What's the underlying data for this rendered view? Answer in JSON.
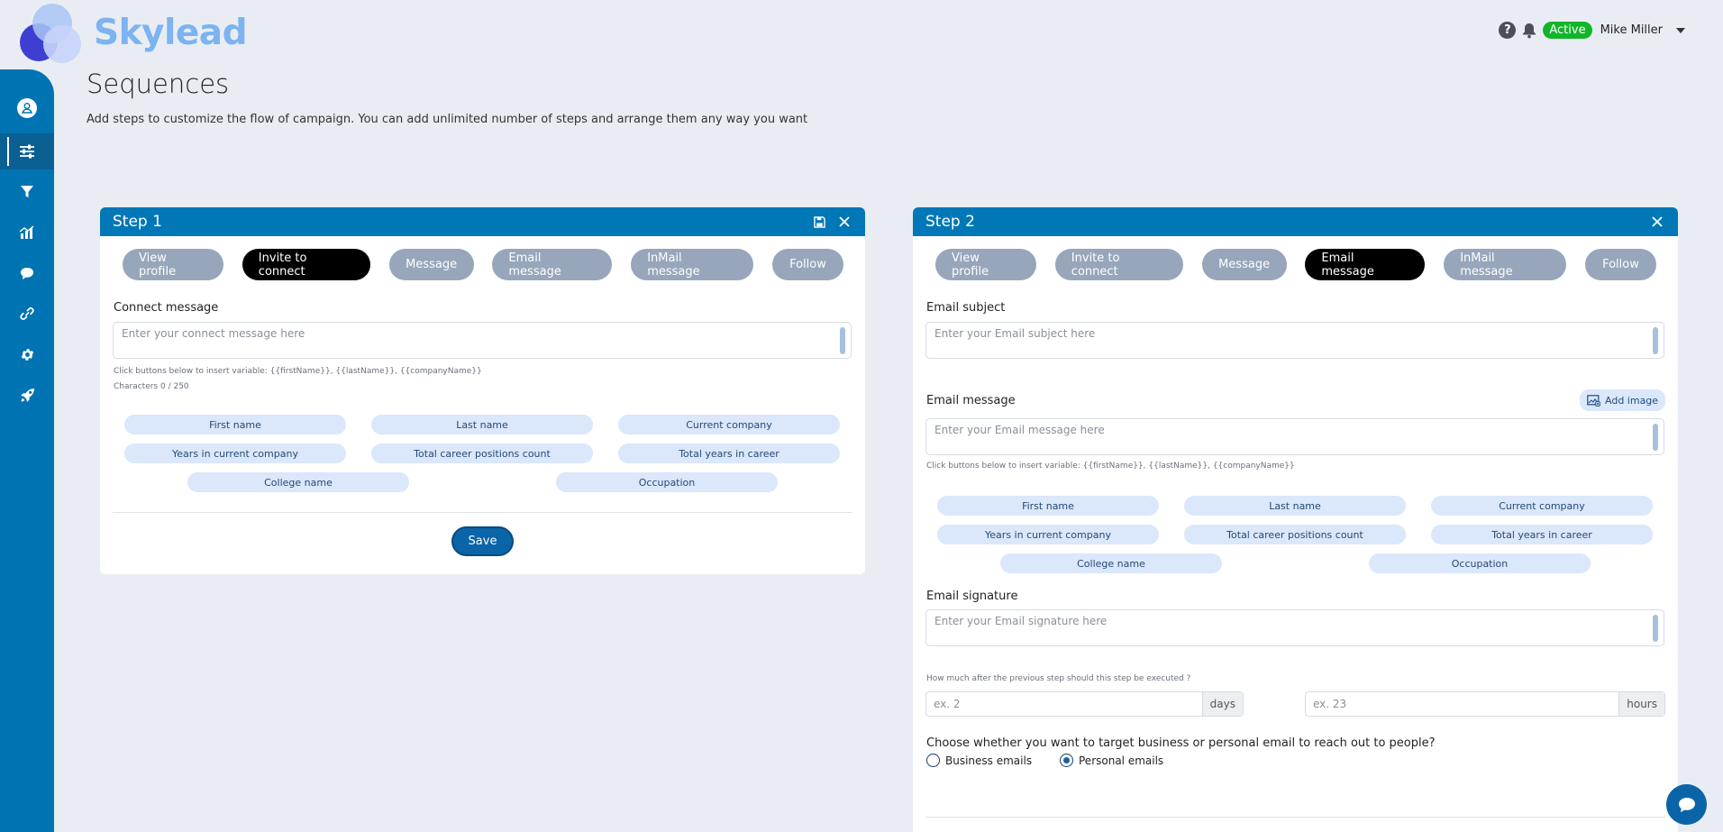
{
  "brand": {
    "name": "Skylead"
  },
  "topbar": {
    "help_icon": "question-circle-icon",
    "bell_icon": "bell-icon",
    "status": "Active",
    "user_name": "Mike Miller",
    "status_color": "#11b52a"
  },
  "sidebar": {
    "items": [
      {
        "icon": "user-icon"
      },
      {
        "icon": "sliders-icon"
      },
      {
        "icon": "filter-icon"
      },
      {
        "icon": "chart-icon"
      },
      {
        "icon": "chat-icon"
      },
      {
        "icon": "link-icon"
      },
      {
        "icon": "gear-icon"
      },
      {
        "icon": "rocket-icon"
      }
    ]
  },
  "page": {
    "title": "Sequences",
    "subtitle": "Add steps to customize the flow of campaign. You can add unlimited number of steps and arrange them any way you want"
  },
  "step1": {
    "title": "Step 1",
    "types": [
      "View profile",
      "Invite to connect",
      "Message",
      "Email message",
      "InMail message",
      "Follow"
    ],
    "selected": "Invite to connect",
    "connect_label": "Connect message",
    "connect_placeholder": "Enter your connect message here",
    "hint": "Click buttons below to insert variable: {{firstName}}, {{lastName}}, {{companyName}}",
    "chars": "Characters 0 / 250",
    "variables": [
      "First name",
      "Last name",
      "Current company",
      "Years in current company",
      "Total career positions count",
      "Total years in career",
      "College name",
      "Occupation"
    ],
    "save": "Save"
  },
  "step2": {
    "title": "Step 2",
    "types": [
      "View profile",
      "Invite to connect",
      "Message",
      "Email message",
      "InMail message",
      "Follow"
    ],
    "selected": "Email message",
    "subject_label": "Email subject",
    "subject_placeholder": "Enter your Email subject here",
    "message_label": "Email message",
    "add_image": "Add image",
    "message_placeholder": "Enter your Email message here",
    "hint": "Click buttons below to insert variable: {{firstName}}, {{lastName}}, {{companyName}}",
    "variables": [
      "First name",
      "Last name",
      "Current company",
      "Years in current company",
      "Total career positions count",
      "Total years in career",
      "College name",
      "Occupation"
    ],
    "signature_label": "Email signature",
    "signature_placeholder": "Enter your Email signature here",
    "delay_question": "How much after the previous step should this step be executed ?",
    "days_placeholder": "ex. 2",
    "days_unit": "days",
    "hours_placeholder": "ex. 23",
    "hours_unit": "hours",
    "target_question": "Choose whether you want to target business or personal email to reach out to people?",
    "options": [
      "Business emails",
      "Personal emails"
    ],
    "selected_option": "Personal emails"
  },
  "colors": {
    "primary": "#0077b6",
    "sidebar": "#0074b3",
    "chip": "#dbe7fa",
    "type_btn": "#97a6bb"
  }
}
